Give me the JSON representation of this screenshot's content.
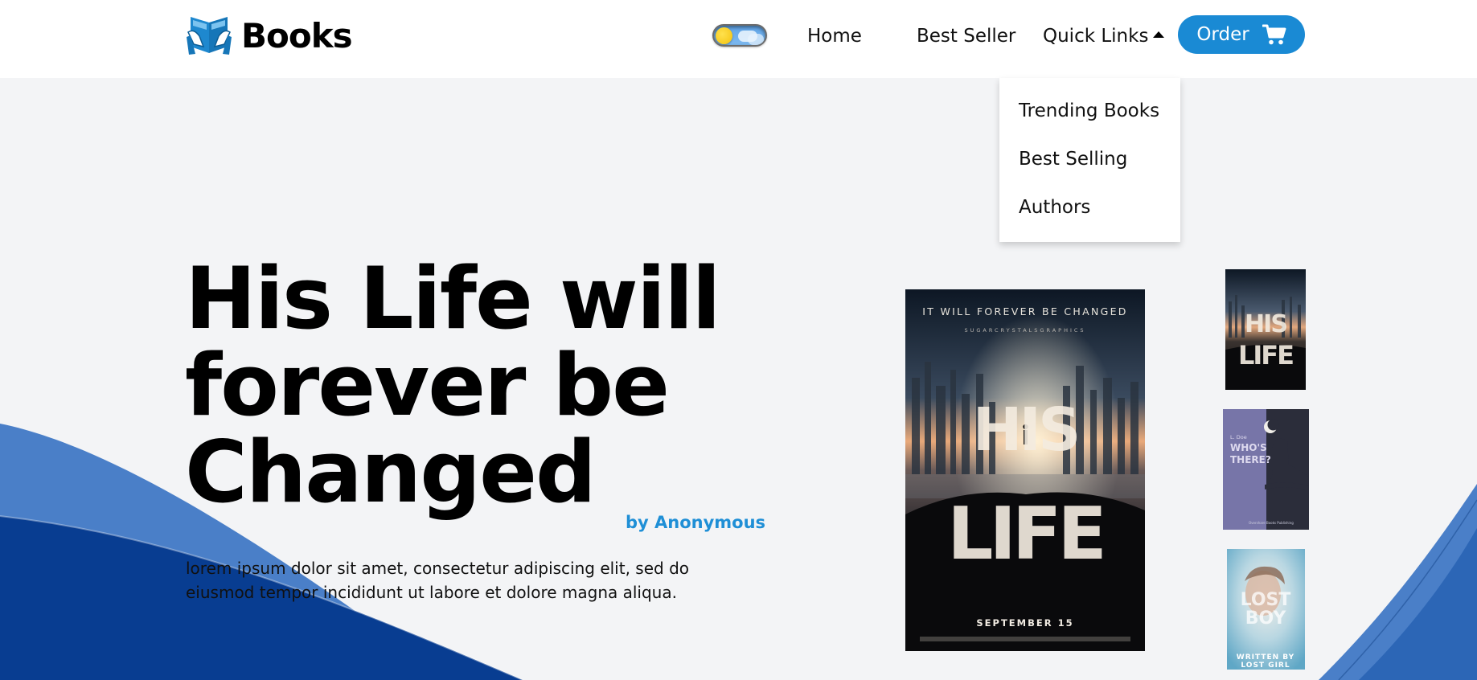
{
  "header": {
    "logo_text": "Books",
    "nav": {
      "home": "Home",
      "best_seller": "Best Seller",
      "quick_links": "Quick Links"
    },
    "order_label": "Order"
  },
  "dropdown": {
    "items": [
      "Trending Books",
      "Best Selling",
      "Authors"
    ]
  },
  "hero": {
    "title_lines": [
      "His Life will",
      "forever be",
      "Changed"
    ],
    "author": "by Anonymous",
    "description": "lorem ipsum dolor sit amet, consectetur adipiscing elit, sed do eiusmod tempor incididunt ut labore et dolore magna aliqua."
  },
  "covers": {
    "main": {
      "tagline": "IT WILL FOREVER BE CHANGED",
      "credit": "SUGARCRYSTALSGRAPHICS",
      "title_top": "HIS",
      "title_bottom": "LIFE",
      "date": "SEPTEMBER 15"
    },
    "thumb2": {
      "author": "L. Doe",
      "title_line1": "WHO'S",
      "title_line2": "THERE?",
      "publisher": "Overshare Books Publishing"
    },
    "thumb3": {
      "title_line1": "LOST",
      "title_line2": "BOY",
      "written_by": "WRITTEN BY",
      "author": "LOST GIRL"
    }
  },
  "icons": {
    "logo": "open-book-icon",
    "cart": "shopping-cart-icon",
    "caret": "caret-up-icon",
    "theme": "sun-toggle-icon"
  },
  "colors": {
    "accent": "#1a8ad4",
    "author": "#1f8fd6",
    "wave_light": "#4a7fc8",
    "wave_dark": "#083d91",
    "background": "#f3f4f6"
  }
}
